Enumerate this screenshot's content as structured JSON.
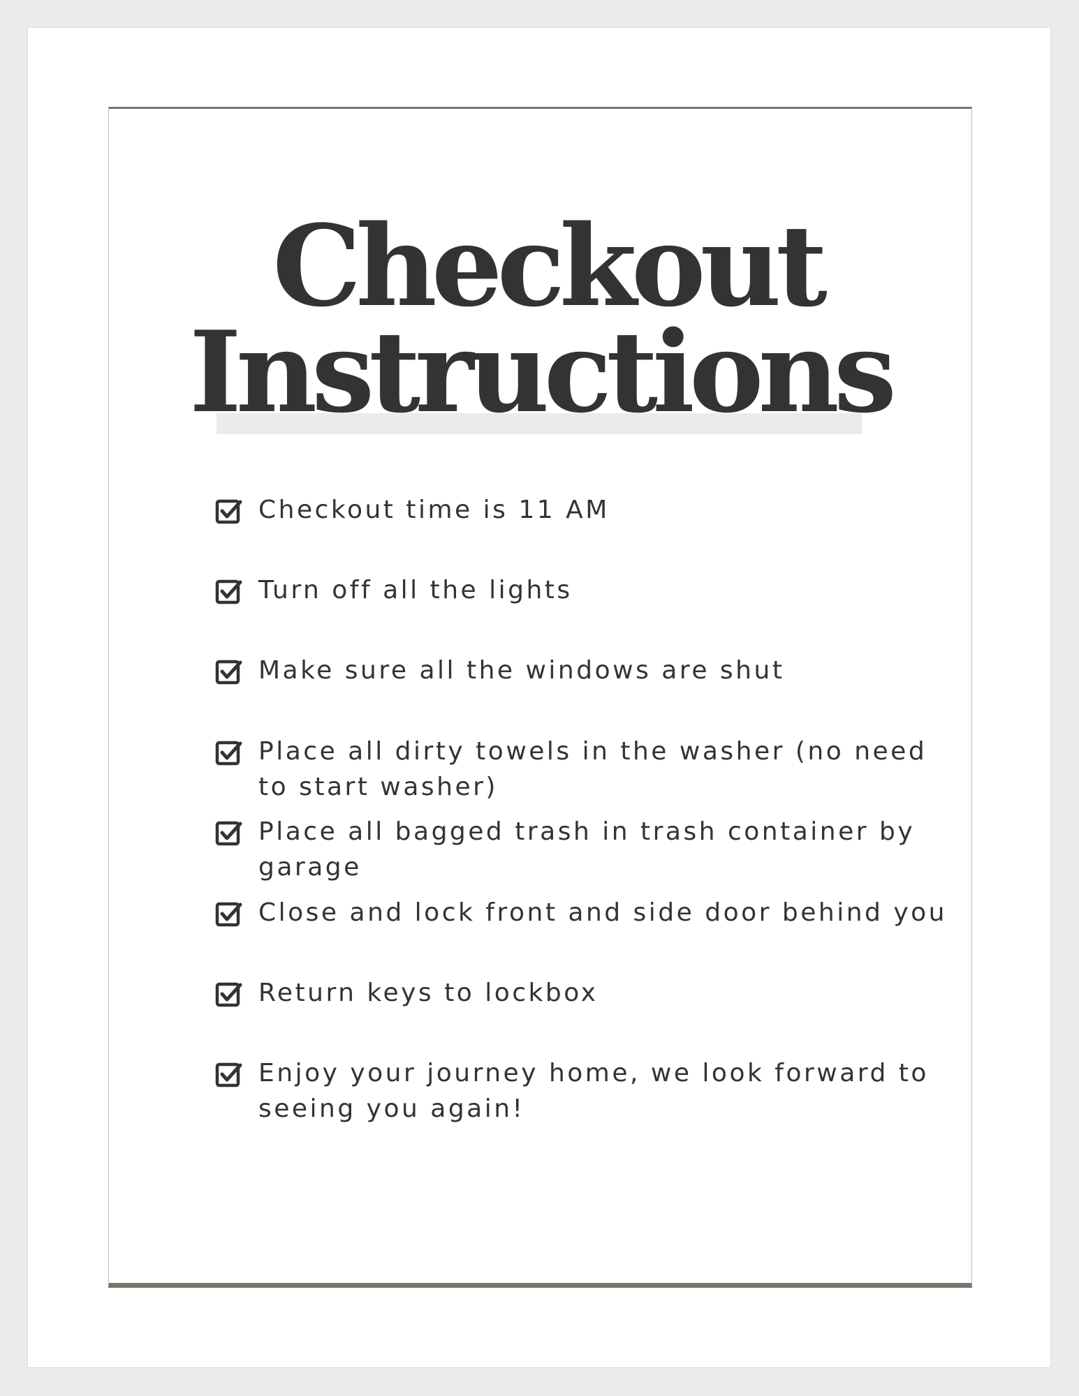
{
  "title": {
    "line1": "Checkout",
    "line2": "Instructions"
  },
  "checklist": {
    "icon": "checked-box-icon",
    "items": [
      {
        "text": "Checkout time is 11 AM"
      },
      {
        "text": "Turn off all the lights"
      },
      {
        "text": "Make sure all the windows are shut"
      },
      {
        "text": "Place all dirty towels in the washer (no need to start washer)"
      },
      {
        "text": "Place all bagged trash in trash container by garage"
      },
      {
        "text": "Close and lock front and side door behind you"
      },
      {
        "text": "Return keys to lockbox"
      },
      {
        "text": "Enjoy your journey home, we look forward to seeing you again!"
      }
    ]
  },
  "colors": {
    "text": "#333333",
    "frame": "#7b746d",
    "background": "#ebebea",
    "paper": "#ffffff"
  }
}
